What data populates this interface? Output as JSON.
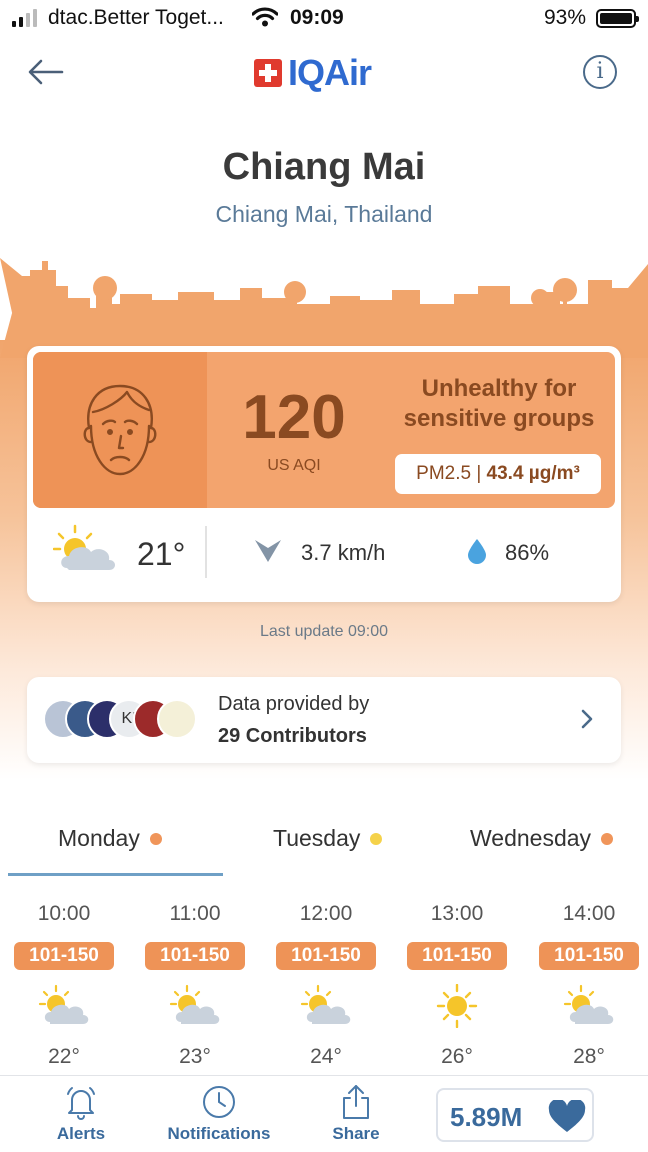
{
  "status_bar": {
    "carrier": "dtac.Better Toget...",
    "time": "09:09",
    "battery_percent": "93%",
    "battery_level": 0.93
  },
  "header": {
    "logo_text": "IQAir",
    "info_label": "i"
  },
  "location": {
    "city": "Chiang Mai",
    "region": "Chiang Mai, Thailand"
  },
  "aqi": {
    "value": "120",
    "unit": "US AQI",
    "status": "Unhealthy for sensitive groups",
    "pollutant_name": "PM2.5 | ",
    "pollutant_value": "43.4 µg/m³",
    "color": "#f3a46e"
  },
  "weather": {
    "temperature": "21°",
    "wind": "3.7 km/h",
    "humidity": "86%"
  },
  "last_update": "Last update 09:00",
  "contributors": {
    "label": "Data provided by",
    "count": "29 Contributors",
    "avatar_text": "KI"
  },
  "forecast": {
    "tabs": [
      {
        "label": "Monday",
        "dot_color": "#f0955a"
      },
      {
        "label": "Tuesday",
        "dot_color": "#f5d24a"
      },
      {
        "label": "Wednesday",
        "dot_color": "#f0955a"
      }
    ],
    "hours": [
      {
        "time": "10:00",
        "range": "101-150",
        "icon": "partly-cloudy-icon",
        "temp": "22°"
      },
      {
        "time": "11:00",
        "range": "101-150",
        "icon": "partly-cloudy-icon",
        "temp": "23°"
      },
      {
        "time": "12:00",
        "range": "101-150",
        "icon": "partly-cloudy-icon",
        "temp": "24°"
      },
      {
        "time": "13:00",
        "range": "101-150",
        "icon": "sun-icon",
        "temp": "26°"
      },
      {
        "time": "14:00",
        "range": "101-150",
        "icon": "partly-cloudy-icon",
        "temp": "28°"
      }
    ]
  },
  "bottom_nav": {
    "alerts": "Alerts",
    "notifications": "Notifications",
    "share": "Share",
    "followers": "5.89M"
  }
}
